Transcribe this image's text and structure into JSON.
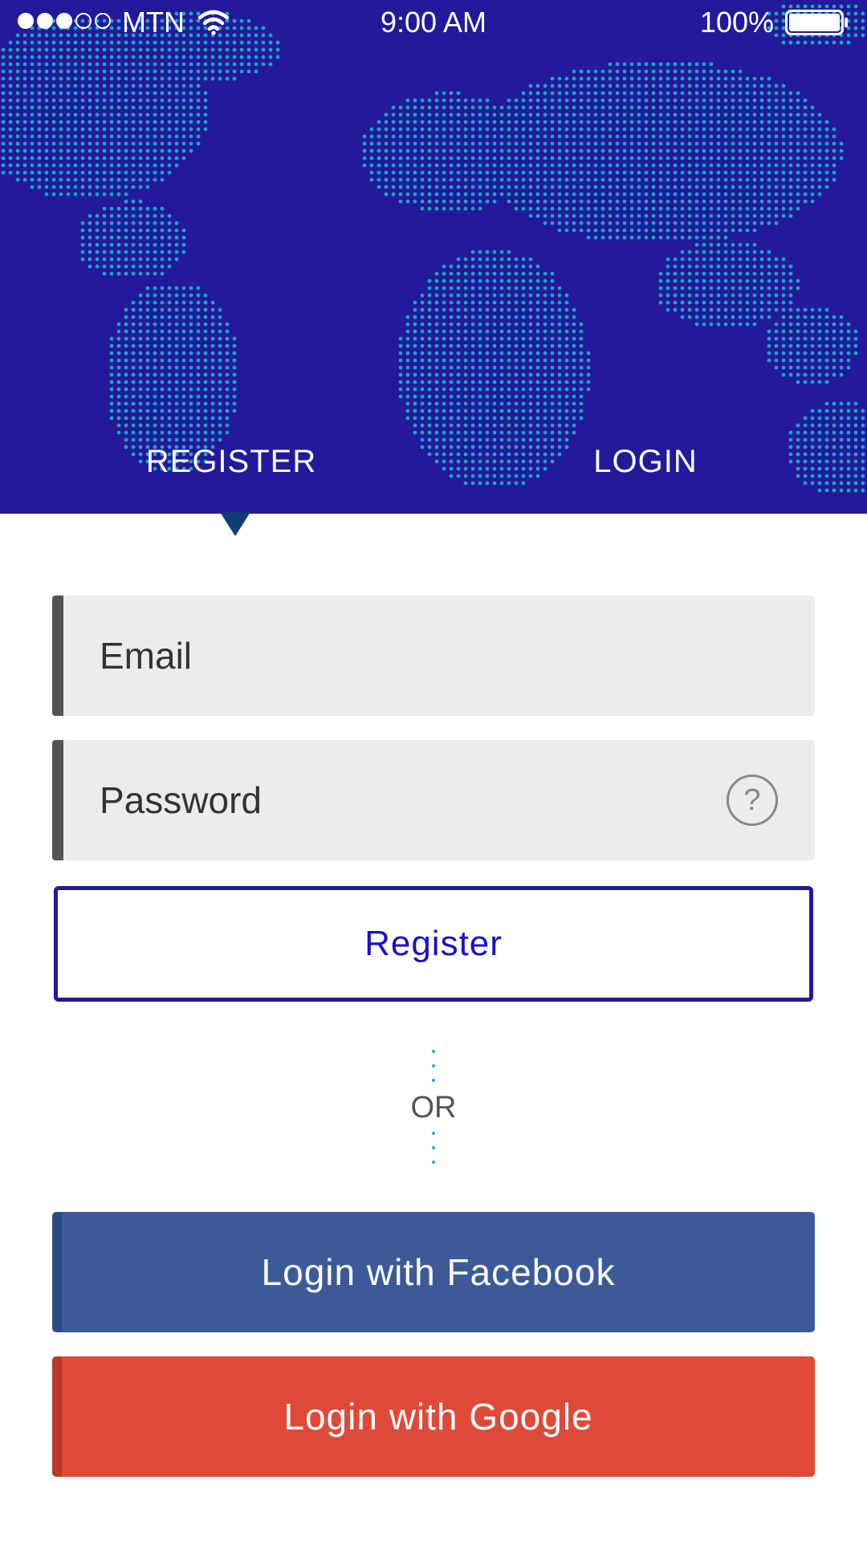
{
  "status_bar": {
    "carrier": "MTN",
    "time": "9:00 AM",
    "battery_percent": "100%",
    "signal_bars_filled": 3,
    "signal_bars_total": 5,
    "battery_level": 1.0
  },
  "tabs": [
    {
      "label": "REGISTER",
      "active": true
    },
    {
      "label": "LOGIN",
      "active": false
    }
  ],
  "form": {
    "email": {
      "placeholder": "Email",
      "value": ""
    },
    "password": {
      "placeholder": "Password",
      "value": ""
    },
    "help_glyph": "?",
    "register_label": "Register"
  },
  "divider": {
    "label": "OR"
  },
  "social": {
    "facebook_label": "Login with Facebook",
    "google_label": "Login with Google"
  },
  "colors": {
    "header_bg": "#24199a",
    "map_dots": "#17a7c4",
    "accent": "#24199a",
    "facebook": "#3d5a98",
    "google": "#df4a38",
    "field_bg": "#ececec"
  },
  "icons": [
    "signal-dots-icon",
    "wifi-icon",
    "battery-icon",
    "help-icon"
  ]
}
